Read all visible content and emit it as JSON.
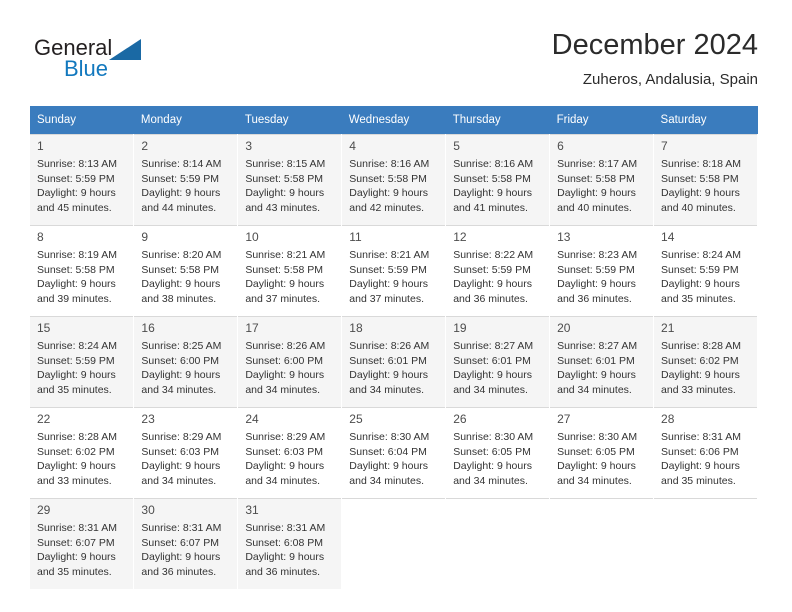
{
  "brand": {
    "name_top": "General",
    "name_bottom": "Blue",
    "triangle_color": "#1a69a4",
    "blue_color": "#1278be"
  },
  "header": {
    "title": "December 2024",
    "subtitle": "Zuheros, Andalusia, Spain"
  },
  "calendar": {
    "header_bg": "#3a7cbe",
    "header_text_color": "#ffffff",
    "shaded_row_bg": "#f5f5f5",
    "weekdays": [
      "Sunday",
      "Monday",
      "Tuesday",
      "Wednesday",
      "Thursday",
      "Friday",
      "Saturday"
    ],
    "weeks": [
      [
        {
          "day": "1",
          "sunrise": "Sunrise: 8:13 AM",
          "sunset": "Sunset: 5:59 PM",
          "daylight_line1": "Daylight: 9 hours",
          "daylight_line2": "and 45 minutes."
        },
        {
          "day": "2",
          "sunrise": "Sunrise: 8:14 AM",
          "sunset": "Sunset: 5:59 PM",
          "daylight_line1": "Daylight: 9 hours",
          "daylight_line2": "and 44 minutes."
        },
        {
          "day": "3",
          "sunrise": "Sunrise: 8:15 AM",
          "sunset": "Sunset: 5:58 PM",
          "daylight_line1": "Daylight: 9 hours",
          "daylight_line2": "and 43 minutes."
        },
        {
          "day": "4",
          "sunrise": "Sunrise: 8:16 AM",
          "sunset": "Sunset: 5:58 PM",
          "daylight_line1": "Daylight: 9 hours",
          "daylight_line2": "and 42 minutes."
        },
        {
          "day": "5",
          "sunrise": "Sunrise: 8:16 AM",
          "sunset": "Sunset: 5:58 PM",
          "daylight_line1": "Daylight: 9 hours",
          "daylight_line2": "and 41 minutes."
        },
        {
          "day": "6",
          "sunrise": "Sunrise: 8:17 AM",
          "sunset": "Sunset: 5:58 PM",
          "daylight_line1": "Daylight: 9 hours",
          "daylight_line2": "and 40 minutes."
        },
        {
          "day": "7",
          "sunrise": "Sunrise: 8:18 AM",
          "sunset": "Sunset: 5:58 PM",
          "daylight_line1": "Daylight: 9 hours",
          "daylight_line2": "and 40 minutes."
        }
      ],
      [
        {
          "day": "8",
          "sunrise": "Sunrise: 8:19 AM",
          "sunset": "Sunset: 5:58 PM",
          "daylight_line1": "Daylight: 9 hours",
          "daylight_line2": "and 39 minutes."
        },
        {
          "day": "9",
          "sunrise": "Sunrise: 8:20 AM",
          "sunset": "Sunset: 5:58 PM",
          "daylight_line1": "Daylight: 9 hours",
          "daylight_line2": "and 38 minutes."
        },
        {
          "day": "10",
          "sunrise": "Sunrise: 8:21 AM",
          "sunset": "Sunset: 5:58 PM",
          "daylight_line1": "Daylight: 9 hours",
          "daylight_line2": "and 37 minutes."
        },
        {
          "day": "11",
          "sunrise": "Sunrise: 8:21 AM",
          "sunset": "Sunset: 5:59 PM",
          "daylight_line1": "Daylight: 9 hours",
          "daylight_line2": "and 37 minutes."
        },
        {
          "day": "12",
          "sunrise": "Sunrise: 8:22 AM",
          "sunset": "Sunset: 5:59 PM",
          "daylight_line1": "Daylight: 9 hours",
          "daylight_line2": "and 36 minutes."
        },
        {
          "day": "13",
          "sunrise": "Sunrise: 8:23 AM",
          "sunset": "Sunset: 5:59 PM",
          "daylight_line1": "Daylight: 9 hours",
          "daylight_line2": "and 36 minutes."
        },
        {
          "day": "14",
          "sunrise": "Sunrise: 8:24 AM",
          "sunset": "Sunset: 5:59 PM",
          "daylight_line1": "Daylight: 9 hours",
          "daylight_line2": "and 35 minutes."
        }
      ],
      [
        {
          "day": "15",
          "sunrise": "Sunrise: 8:24 AM",
          "sunset": "Sunset: 5:59 PM",
          "daylight_line1": "Daylight: 9 hours",
          "daylight_line2": "and 35 minutes."
        },
        {
          "day": "16",
          "sunrise": "Sunrise: 8:25 AM",
          "sunset": "Sunset: 6:00 PM",
          "daylight_line1": "Daylight: 9 hours",
          "daylight_line2": "and 34 minutes."
        },
        {
          "day": "17",
          "sunrise": "Sunrise: 8:26 AM",
          "sunset": "Sunset: 6:00 PM",
          "daylight_line1": "Daylight: 9 hours",
          "daylight_line2": "and 34 minutes."
        },
        {
          "day": "18",
          "sunrise": "Sunrise: 8:26 AM",
          "sunset": "Sunset: 6:01 PM",
          "daylight_line1": "Daylight: 9 hours",
          "daylight_line2": "and 34 minutes."
        },
        {
          "day": "19",
          "sunrise": "Sunrise: 8:27 AM",
          "sunset": "Sunset: 6:01 PM",
          "daylight_line1": "Daylight: 9 hours",
          "daylight_line2": "and 34 minutes."
        },
        {
          "day": "20",
          "sunrise": "Sunrise: 8:27 AM",
          "sunset": "Sunset: 6:01 PM",
          "daylight_line1": "Daylight: 9 hours",
          "daylight_line2": "and 34 minutes."
        },
        {
          "day": "21",
          "sunrise": "Sunrise: 8:28 AM",
          "sunset": "Sunset: 6:02 PM",
          "daylight_line1": "Daylight: 9 hours",
          "daylight_line2": "and 33 minutes."
        }
      ],
      [
        {
          "day": "22",
          "sunrise": "Sunrise: 8:28 AM",
          "sunset": "Sunset: 6:02 PM",
          "daylight_line1": "Daylight: 9 hours",
          "daylight_line2": "and 33 minutes."
        },
        {
          "day": "23",
          "sunrise": "Sunrise: 8:29 AM",
          "sunset": "Sunset: 6:03 PM",
          "daylight_line1": "Daylight: 9 hours",
          "daylight_line2": "and 34 minutes."
        },
        {
          "day": "24",
          "sunrise": "Sunrise: 8:29 AM",
          "sunset": "Sunset: 6:03 PM",
          "daylight_line1": "Daylight: 9 hours",
          "daylight_line2": "and 34 minutes."
        },
        {
          "day": "25",
          "sunrise": "Sunrise: 8:30 AM",
          "sunset": "Sunset: 6:04 PM",
          "daylight_line1": "Daylight: 9 hours",
          "daylight_line2": "and 34 minutes."
        },
        {
          "day": "26",
          "sunrise": "Sunrise: 8:30 AM",
          "sunset": "Sunset: 6:05 PM",
          "daylight_line1": "Daylight: 9 hours",
          "daylight_line2": "and 34 minutes."
        },
        {
          "day": "27",
          "sunrise": "Sunrise: 8:30 AM",
          "sunset": "Sunset: 6:05 PM",
          "daylight_line1": "Daylight: 9 hours",
          "daylight_line2": "and 34 minutes."
        },
        {
          "day": "28",
          "sunrise": "Sunrise: 8:31 AM",
          "sunset": "Sunset: 6:06 PM",
          "daylight_line1": "Daylight: 9 hours",
          "daylight_line2": "and 35 minutes."
        }
      ],
      [
        {
          "day": "29",
          "sunrise": "Sunrise: 8:31 AM",
          "sunset": "Sunset: 6:07 PM",
          "daylight_line1": "Daylight: 9 hours",
          "daylight_line2": "and 35 minutes."
        },
        {
          "day": "30",
          "sunrise": "Sunrise: 8:31 AM",
          "sunset": "Sunset: 6:07 PM",
          "daylight_line1": "Daylight: 9 hours",
          "daylight_line2": "and 36 minutes."
        },
        {
          "day": "31",
          "sunrise": "Sunrise: 8:31 AM",
          "sunset": "Sunset: 6:08 PM",
          "daylight_line1": "Daylight: 9 hours",
          "daylight_line2": "and 36 minutes."
        },
        null,
        null,
        null,
        null
      ]
    ]
  }
}
